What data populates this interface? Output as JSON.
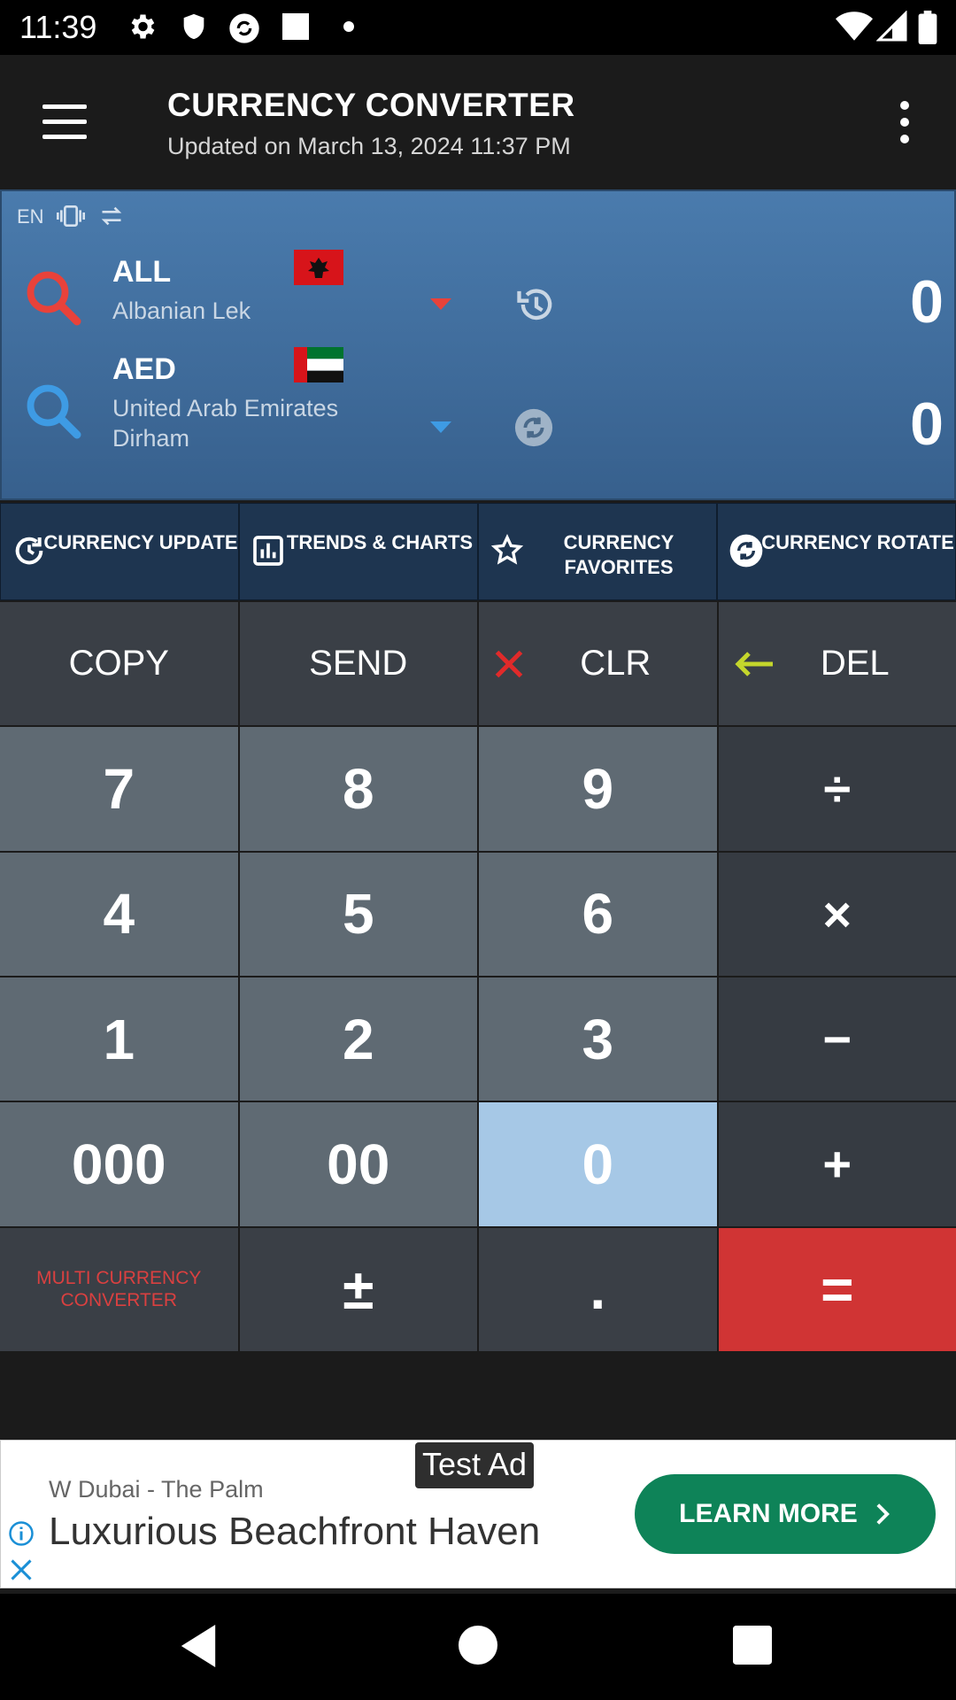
{
  "status_bar": {
    "time": "11:39"
  },
  "header": {
    "title": "CURRENCY CONVERTER",
    "subtitle": "Updated on March 13, 2024 11:37 PM"
  },
  "converter": {
    "lang": "EN",
    "from": {
      "code": "ALL",
      "name": "Albanian Lek",
      "amount": "0",
      "accent": "#e8423a"
    },
    "to": {
      "code": "AED",
      "name": "United Arab Emirates Dirham",
      "amount": "0",
      "accent": "#3e9be4"
    }
  },
  "actions": [
    {
      "label": "CURRENCY UPDATE",
      "icon": "refresh-clock-icon"
    },
    {
      "label": "TRENDS & CHARTS",
      "icon": "bar-chart-icon"
    },
    {
      "label": "CURRENCY FAVORITES",
      "icon": "star-icon"
    },
    {
      "label": "CURRENCY ROTATE",
      "icon": "rotate-icon"
    }
  ],
  "keypad": {
    "copy": "COPY",
    "send": "SEND",
    "clr": "CLR",
    "del": "DEL",
    "k7": "7",
    "k8": "8",
    "k9": "9",
    "divide": "÷",
    "k4": "4",
    "k5": "5",
    "k6": "6",
    "multiply": "×",
    "k1": "1",
    "k2": "2",
    "k3": "3",
    "minus": "−",
    "k000": "000",
    "k00": "00",
    "k0": "0",
    "plus": "+",
    "multi": "MULTI CURRENCY CONVERTER",
    "plus_minus": "±",
    "dot": ".",
    "equals": "="
  },
  "ad": {
    "tag": "Test Ad",
    "advertiser": "W Dubai - The Palm",
    "headline": "Luxurious Beachfront Haven",
    "cta": "LEARN MORE"
  },
  "colors": {
    "equals_bg": "#d03434",
    "selected_key": "#a6c8e6",
    "cta_green": "#0e8358"
  }
}
